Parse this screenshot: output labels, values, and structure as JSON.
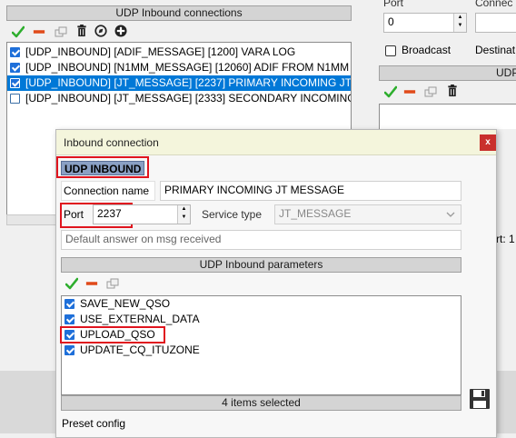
{
  "left_panel": {
    "title": "UDP Inbound connections",
    "rows": [
      {
        "label": "[UDP_INBOUND] [ADIF_MESSAGE] [1200] VARA LOG",
        "checked": true
      },
      {
        "label": "[UDP_INBOUND] [N1MM_MESSAGE] [12060] ADIF FROM N1MM",
        "checked": true
      },
      {
        "label": "[UDP_INBOUND] [JT_MESSAGE] [2237] PRIMARY INCOMING JT",
        "checked": true,
        "selected": true
      },
      {
        "label": "[UDP_INBOUND] [JT_MESSAGE] [2333] SECONDARY INCOMING",
        "checked": false
      }
    ]
  },
  "right_panel": {
    "port_label": "Port",
    "port_value": "0",
    "connect_label": "Connec",
    "broadcast_label": "Broadcast",
    "destination_label": "Destinat",
    "header_partial": "UDP",
    "status_partial": "rt: 1"
  },
  "dialog": {
    "title": "Inbound connection",
    "close_label": "x",
    "type_badge": "UDP INBOUND",
    "connection_name_label": "Connection name",
    "connection_name_value": "PRIMARY INCOMING JT MESSAGE",
    "port_label": "Port",
    "port_value": "2237",
    "service_type_label": "Service type",
    "service_type_value": "JT_MESSAGE",
    "default_answer_placeholder": "Default answer on msg received",
    "params_header": "UDP Inbound parameters",
    "params": [
      {
        "label": "SAVE_NEW_QSO",
        "checked": true
      },
      {
        "label": "USE_EXTERNAL_DATA",
        "checked": true
      },
      {
        "label": "UPLOAD_QSO",
        "checked": true
      },
      {
        "label": "UPDATE_CQ_ITUZONE",
        "checked": true
      }
    ],
    "items_selected": "4 items selected",
    "preset_label": "Preset config"
  },
  "colors": {
    "selection": "#0078d7",
    "highlight_border": "#e0141e",
    "check_green": "#2eae2e",
    "delete_red": "#e04a1a"
  }
}
